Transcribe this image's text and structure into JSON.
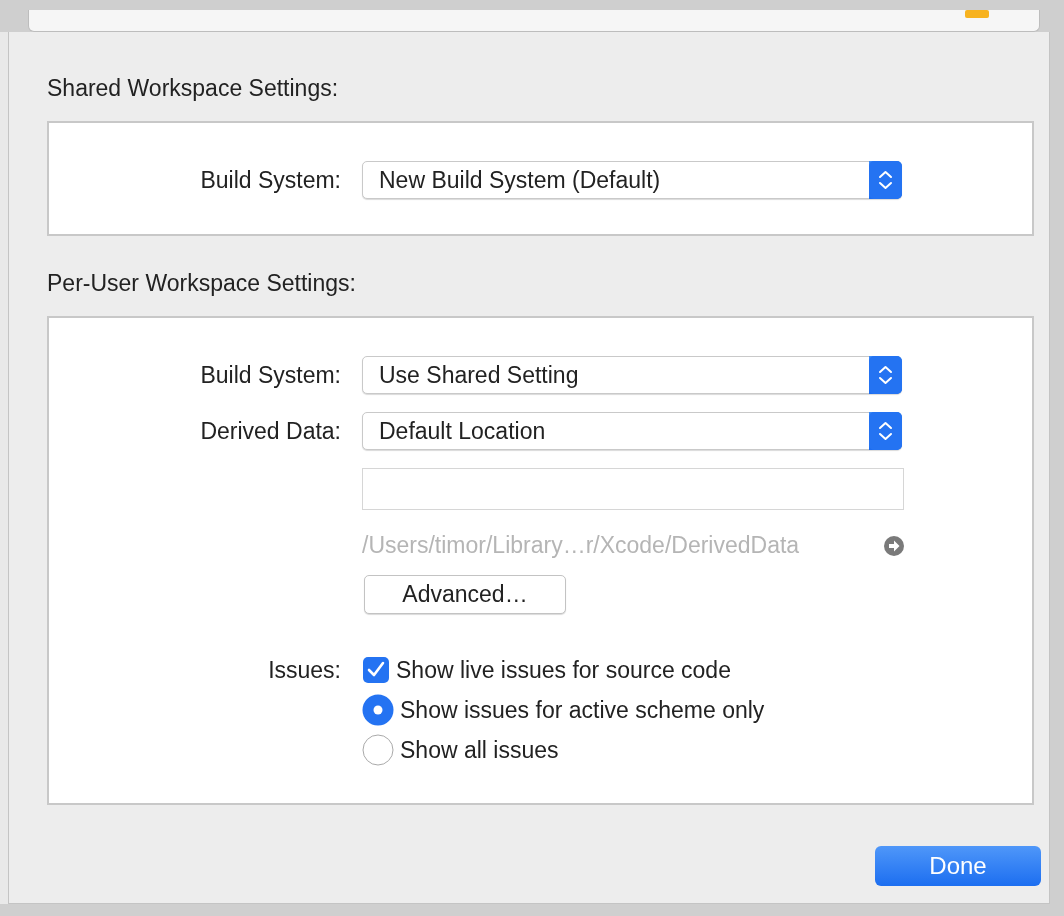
{
  "shared_settings": {
    "title": "Shared Workspace Settings:",
    "rows": [
      {
        "label": "Build System:",
        "value": "New Build System (Default)"
      }
    ]
  },
  "per_user_settings": {
    "title": "Per-User Workspace Settings:",
    "rows": [
      {
        "label": "Build System:",
        "value": "Use Shared Setting"
      },
      {
        "label": "Derived Data:",
        "value": "Default Location"
      }
    ],
    "path": "/Users/timor/Library…r/Xcode/DerivedData",
    "advanced_button": "Advanced…",
    "issues": {
      "label": "Issues:",
      "options": [
        {
          "kind": "checkbox",
          "label": "Show live issues for source code",
          "checked": true
        },
        {
          "kind": "radio",
          "label": "Show issues for active scheme only",
          "selected": true
        },
        {
          "kind": "radio",
          "label": "Show all issues",
          "selected": false
        }
      ]
    }
  },
  "done_button": "Done"
}
